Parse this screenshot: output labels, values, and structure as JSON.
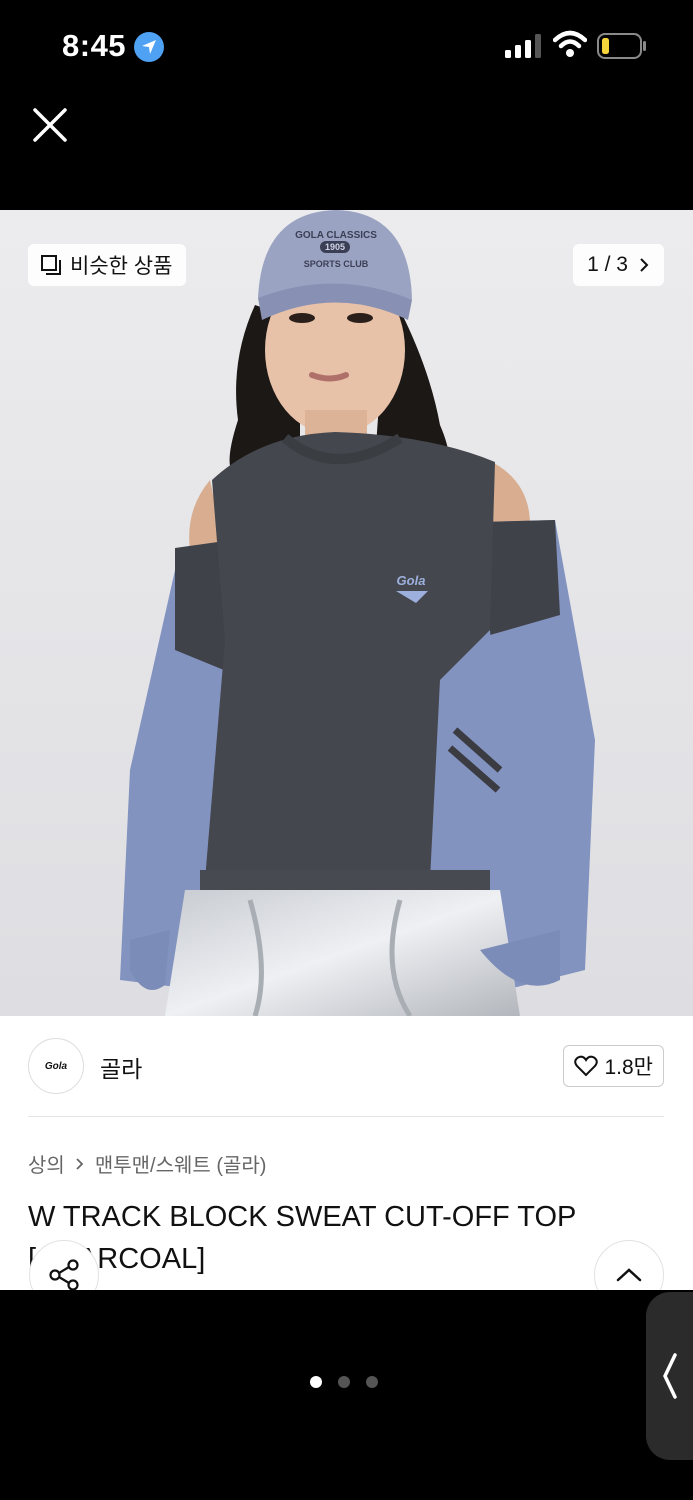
{
  "status_bar": {
    "time": "8:45"
  },
  "gallery": {
    "similar_products_label": "비슷한 상품",
    "pager": "1 / 3",
    "cap_text_line1": "GOLA CLASSICS",
    "cap_text_line2": "1905",
    "cap_text_line3": "SPORTS CLUB",
    "chest_logo": "Gola"
  },
  "brand": {
    "logo_text": "Gola",
    "name": "골라",
    "like_count": "1.8만"
  },
  "breadcrumb": [
    "상의",
    "맨투맨/스웨트 (골라)"
  ],
  "product": {
    "title": "W TRACK BLOCK SWEAT CUT-OFF TOP [CHARCOAL]"
  },
  "pagination": {
    "total": 3,
    "active": 0
  },
  "colors": {
    "background": "#000000",
    "accent_location": "#4ea1f3",
    "battery_level": "#f5d33b"
  }
}
